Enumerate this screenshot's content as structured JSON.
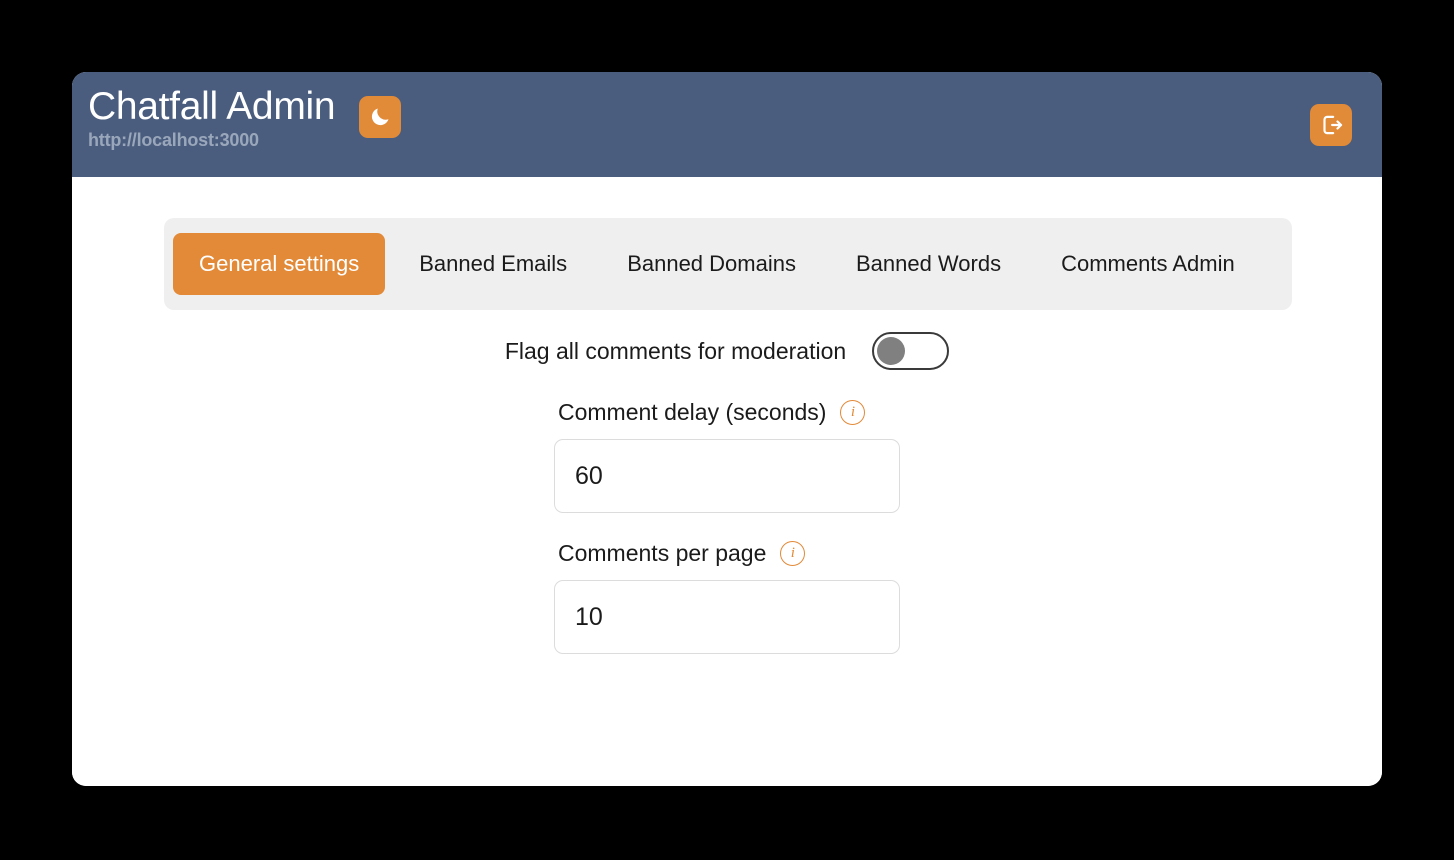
{
  "header": {
    "title": "Chatfall Admin",
    "url": "http://localhost:3000",
    "theme_toggle_icon": "moon-icon",
    "logout_icon": "logout-icon",
    "background_color": "#4a5d7e",
    "accent_color": "#e28a38"
  },
  "tabs": [
    {
      "label": "General settings",
      "active": true
    },
    {
      "label": "Banned Emails",
      "active": false
    },
    {
      "label": "Banned Domains",
      "active": false
    },
    {
      "label": "Banned Words",
      "active": false
    },
    {
      "label": "Comments Admin",
      "active": false
    }
  ],
  "settings": {
    "flag_all": {
      "label": "Flag all comments for moderation",
      "value": "off"
    },
    "comment_delay": {
      "label": "Comment delay (seconds)",
      "value": "60",
      "placeholder": "",
      "info_icon": "info-icon"
    },
    "comments_per_page": {
      "label": "Comments per page",
      "value": "10",
      "placeholder": "",
      "info_icon": "info-icon"
    }
  }
}
